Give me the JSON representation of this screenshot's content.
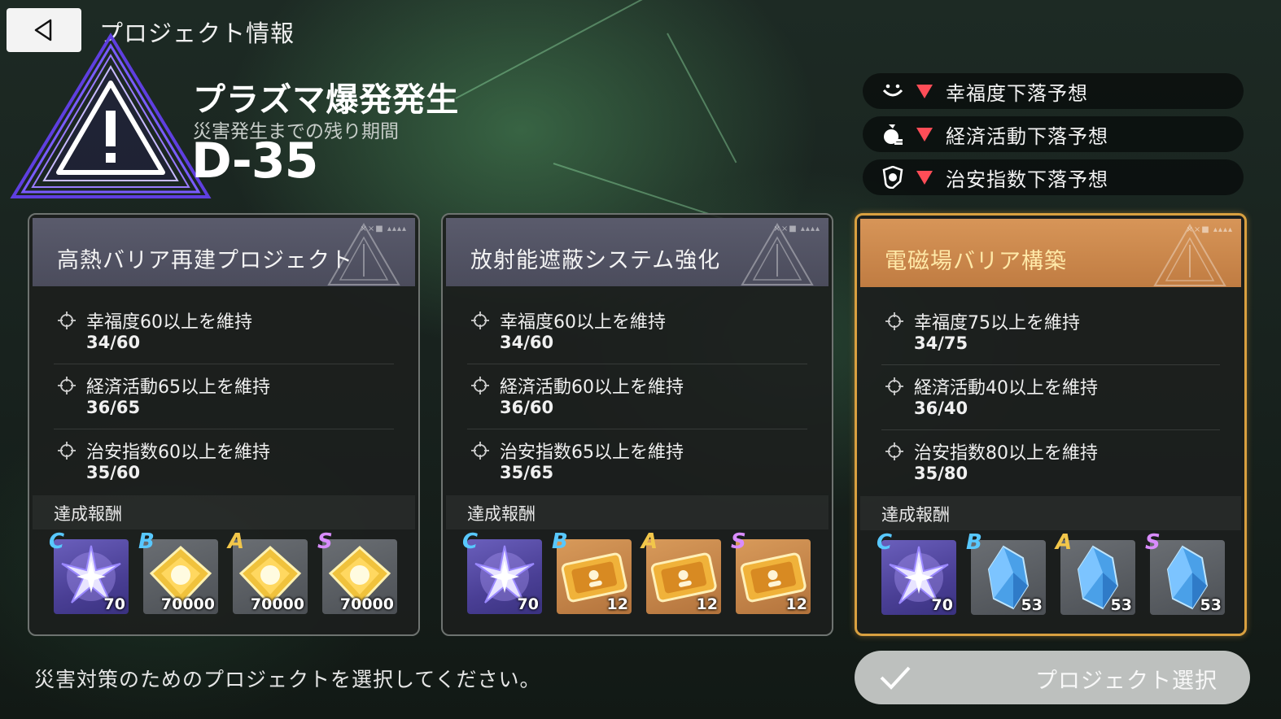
{
  "header": {
    "title": "プロジェクト情報"
  },
  "disaster": {
    "name": "プラズマ爆発発生",
    "remaining_label": "災害発生までの残り期間",
    "countdown": "D-35"
  },
  "forecasts": [
    {
      "icon": "smile-icon",
      "text": "幸福度下落予想"
    },
    {
      "icon": "money-bag-icon",
      "text": "経済活動下落予想"
    },
    {
      "icon": "police-badge-icon",
      "text": "治安指数下落予想"
    }
  ],
  "reward_heading": "達成報酬",
  "cards": [
    {
      "title": "高熱バリア再建プロジェクト",
      "selected": false,
      "conditions": [
        {
          "label": "幸福度60以上を維持",
          "value": "34/60"
        },
        {
          "label": "経済活動65以上を維持",
          "value": "36/65"
        },
        {
          "label": "治安指数60以上を維持",
          "value": "35/60"
        }
      ],
      "rewards": [
        {
          "grade": "C",
          "item": "star-crystal-icon",
          "qty": "70"
        },
        {
          "grade": "B",
          "item": "gold-chip-icon",
          "qty": "70000"
        },
        {
          "grade": "A",
          "item": "gold-chip-icon",
          "qty": "70000"
        },
        {
          "grade": "S",
          "item": "gold-chip-icon",
          "qty": "70000"
        }
      ]
    },
    {
      "title": "放射能遮蔽システム強化",
      "selected": false,
      "conditions": [
        {
          "label": "幸福度60以上を維持",
          "value": "34/60"
        },
        {
          "label": "経済活動60以上を維持",
          "value": "36/60"
        },
        {
          "label": "治安指数65以上を維持",
          "value": "35/65"
        }
      ],
      "rewards": [
        {
          "grade": "C",
          "item": "star-crystal-icon",
          "qty": "70"
        },
        {
          "grade": "B",
          "item": "gold-ticket-icon",
          "qty": "12"
        },
        {
          "grade": "A",
          "item": "gold-ticket-icon",
          "qty": "12"
        },
        {
          "grade": "S",
          "item": "gold-ticket-icon",
          "qty": "12"
        }
      ]
    },
    {
      "title": "電磁場バリア構築",
      "selected": true,
      "conditions": [
        {
          "label": "幸福度75以上を維持",
          "value": "34/75"
        },
        {
          "label": "経済活動40以上を維持",
          "value": "36/40"
        },
        {
          "label": "治安指数80以上を維持",
          "value": "35/80"
        }
      ],
      "rewards": [
        {
          "grade": "C",
          "item": "star-crystal-icon",
          "qty": "70"
        },
        {
          "grade": "B",
          "item": "blue-crystal-icon",
          "qty": "53"
        },
        {
          "grade": "A",
          "item": "blue-crystal-icon",
          "qty": "53"
        },
        {
          "grade": "S",
          "item": "blue-crystal-icon",
          "qty": "53"
        }
      ]
    }
  ],
  "footer": {
    "hint": "災害対策のためのプロジェクトを選択してください。",
    "select_label": "プロジェクト選択"
  },
  "colors": {
    "accent_selected": "#d9a040",
    "warning_red": "#ff4d57",
    "warning_purple": "#7a5cff"
  }
}
